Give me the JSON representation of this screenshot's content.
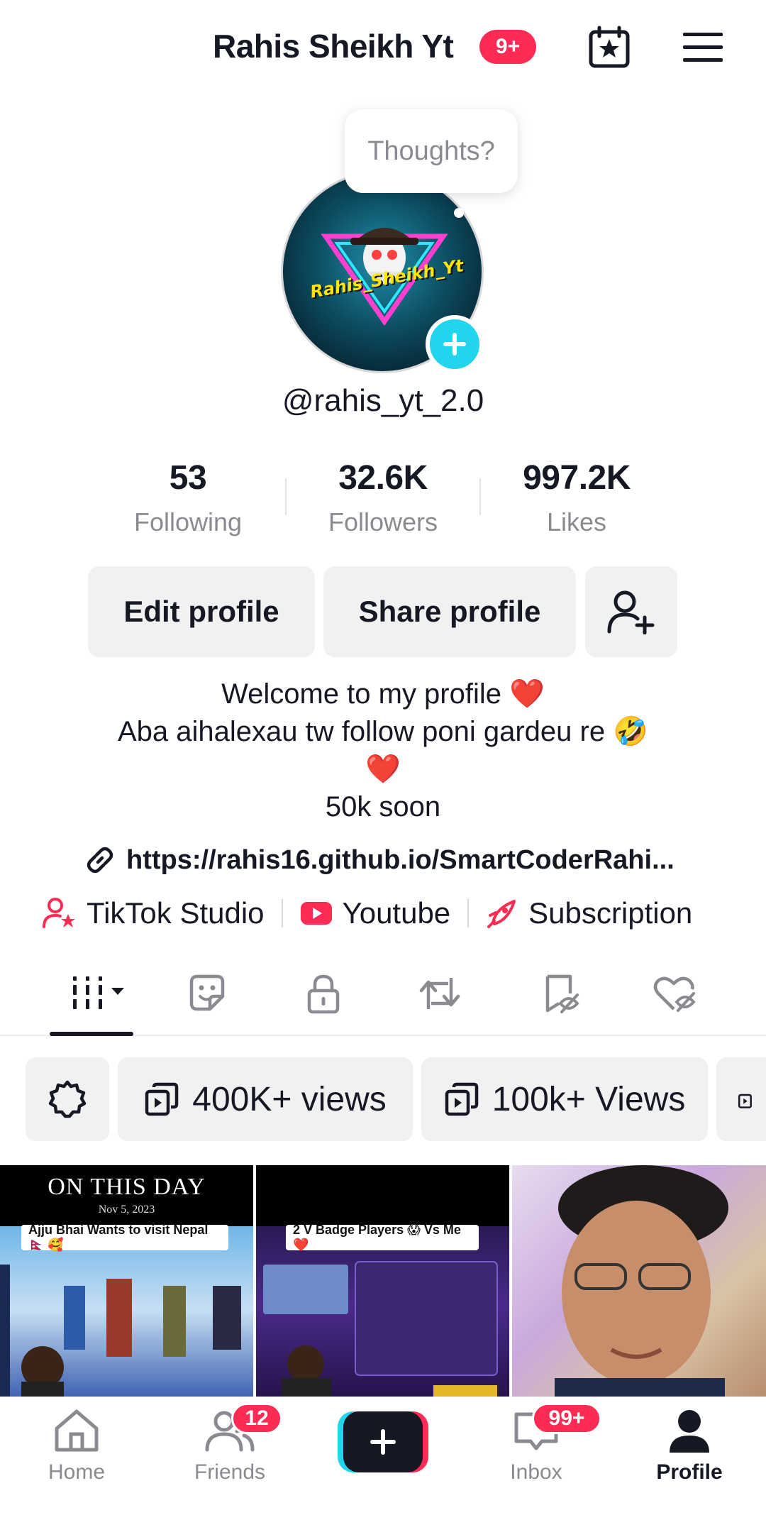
{
  "header": {
    "title": "Rahis Sheikh Yt",
    "notification_badge": "9+",
    "icons": [
      "calendar-star-icon",
      "menu-icon"
    ]
  },
  "avatar": {
    "thought_bubble": "Thoughts?",
    "logo_text": "Rahis_Sheikh_Yt"
  },
  "profile": {
    "username": "@rahis_yt_2.0"
  },
  "stats": [
    {
      "value": "53",
      "label": "Following"
    },
    {
      "value": "32.6K",
      "label": "Followers"
    },
    {
      "value": "997.2K",
      "label": "Likes"
    }
  ],
  "actions": {
    "edit": "Edit profile",
    "share": "Share profile"
  },
  "bio": {
    "line1": "Welcome to my profile ❤️",
    "line2": "Aba aihalexau tw follow poni gardeu re 🤣",
    "line3": "❤️",
    "line4": "50k soon"
  },
  "link": "https://rahis16.github.io/SmartCoderRahi...",
  "chips": [
    {
      "label": "TikTok Studio",
      "icon": "person-star-icon"
    },
    {
      "label": "Youtube",
      "icon": "youtube-icon"
    },
    {
      "label": "Subscription",
      "icon": "rocket-icon"
    }
  ],
  "tabs": [
    "videos-grid-icon",
    "sticker-icon",
    "lock-icon",
    "repost-icon",
    "bookmark-hidden-icon",
    "heart-hidden-icon"
  ],
  "filters": {
    "settings_icon": "gear-icon",
    "items": [
      "400K+ views",
      "100k+ Views"
    ]
  },
  "videos": [
    {
      "heading": "ON THIS DAY",
      "date": "Nov 5, 2023",
      "caption": "Ajju Bhai Wants to visit Nepal🇳🇵 🥰"
    },
    {
      "caption": "2 V Badge Players 😱 Vs Me ❤️"
    },
    {}
  ],
  "bottom_nav": {
    "home": "Home",
    "friends": "Friends",
    "friends_badge": "12",
    "inbox": "Inbox",
    "inbox_badge": "99+",
    "profile": "Profile"
  },
  "colors": {
    "accent": "#fe2c55",
    "cyan": "#20d5ec",
    "text": "#161823",
    "muted": "#8a8b91",
    "button_bg": "#f1f1f2"
  }
}
